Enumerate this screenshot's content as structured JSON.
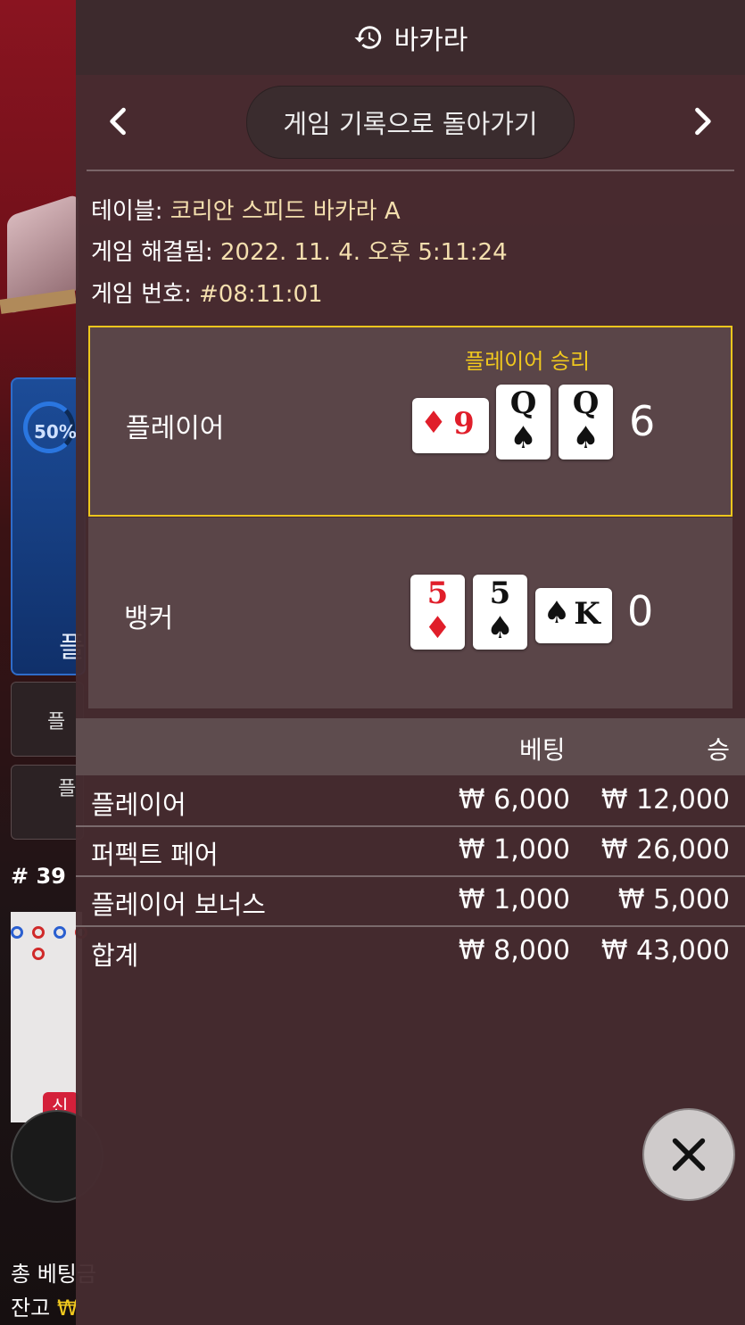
{
  "background": {
    "progress_text": "50%",
    "player_glyph": "플",
    "btn1_text": "플",
    "btn2_text": "플",
    "round_no": "# 39",
    "new_badge": "신",
    "footer_line1": "총 베팅금",
    "footer_line2_prefix": "잔고",
    "footer_line2_value": "₩"
  },
  "header": {
    "title": "바카라",
    "icon": "history-icon"
  },
  "nav": {
    "back_label": "게임 기록으로 돌아가기",
    "prev_icon": "chevron-left-icon",
    "next_icon": "chevron-right-icon"
  },
  "info": {
    "table_label": "테이블:",
    "table_value": "코리안 스피드 바카라 A",
    "resolved_label": "게임 해결됨:",
    "resolved_value": "2022. 11. 4. 오후 5:11:24",
    "number_label": "게임 번호:",
    "number_value": "#08:11:01"
  },
  "result": {
    "winner_label": "플레이어 승리",
    "player": {
      "name": "플레이어",
      "score": "6",
      "cards": [
        {
          "rank": "9",
          "suit": "♦",
          "red": true,
          "sideways": true
        },
        {
          "rank": "Q",
          "suit": "♠",
          "red": false,
          "sideways": false
        },
        {
          "rank": "Q",
          "suit": "♠",
          "red": false,
          "sideways": false
        }
      ]
    },
    "banker": {
      "name": "뱅커",
      "score": "0",
      "cards": [
        {
          "rank": "5",
          "suit": "♦",
          "red": true,
          "sideways": false
        },
        {
          "rank": "5",
          "suit": "♠",
          "red": false,
          "sideways": false
        },
        {
          "rank": "K",
          "suit": "♠",
          "red": false,
          "sideways": true
        }
      ]
    }
  },
  "bets": {
    "col_bet": "베팅",
    "col_win": "승",
    "rows": [
      {
        "name": "플레이어",
        "bet": "₩ 6,000",
        "win": "₩ 12,000"
      },
      {
        "name": "퍼펙트 페어",
        "bet": "₩ 1,000",
        "win": "₩ 26,000"
      },
      {
        "name": "플레이어 보너스",
        "bet": "₩ 1,000",
        "win": "₩ 5,000"
      }
    ],
    "total": {
      "name": "합계",
      "bet": "₩ 8,000",
      "win": "₩ 43,000"
    }
  },
  "close_icon": "close-icon",
  "colors": {
    "accent_gold": "#f0c81e",
    "info_value": "#f4dfae",
    "panel": "#462c30"
  }
}
